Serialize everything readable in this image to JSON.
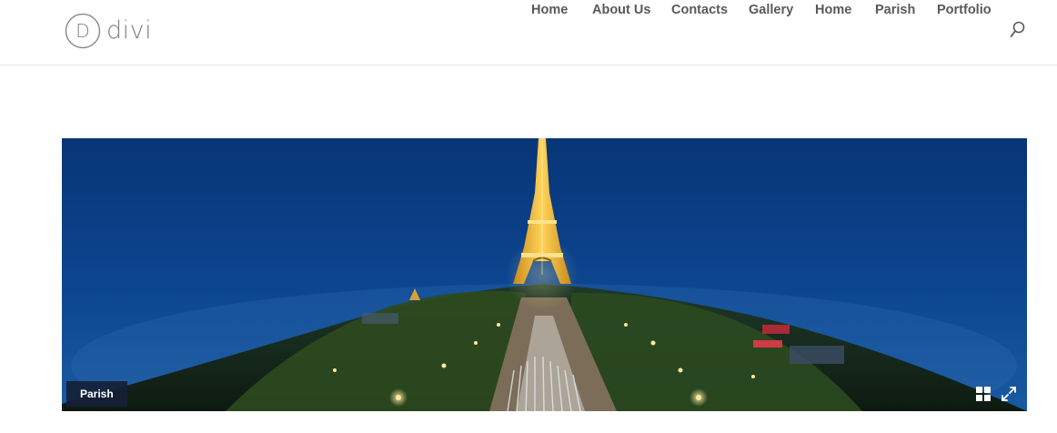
{
  "header": {
    "logo": {
      "letter": "D",
      "text": "divi"
    },
    "nav": {
      "items": [
        {
          "label": "Home",
          "name": "nav-item-home"
        },
        {
          "label": "About Us",
          "name": "nav-item-about-us"
        },
        {
          "label": "Contacts",
          "name": "nav-item-contacts"
        },
        {
          "label": "Gallery",
          "name": "nav-item-gallery"
        },
        {
          "label": "Home",
          "name": "nav-item-home-2"
        },
        {
          "label": "Parish",
          "name": "nav-item-parish"
        },
        {
          "label": "Portfolio",
          "name": "nav-item-portfolio"
        }
      ]
    },
    "search_icon": "search-icon"
  },
  "hero": {
    "image": "eiffel-tower-panorama-night",
    "category_label": "Parish",
    "controls": {
      "grid_icon": "grid-icon",
      "fullscreen_icon": "expand-icon"
    }
  },
  "colors": {
    "nav_text": "#595959",
    "logo_text": "#7b8085",
    "badge_bg": "#162036",
    "sky": "#0a3a7a"
  }
}
